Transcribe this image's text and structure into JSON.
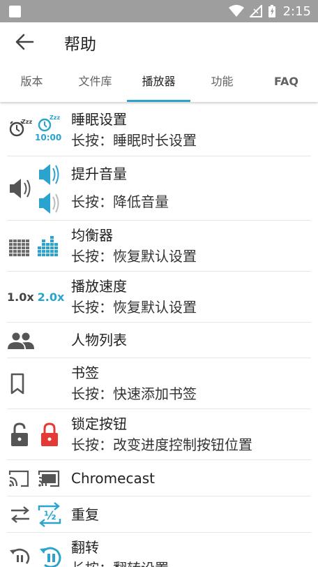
{
  "status": {
    "time": "2:15"
  },
  "appbar": {
    "title": "帮助"
  },
  "tabs": [
    {
      "label": "版本",
      "active": false
    },
    {
      "label": "文件库",
      "active": false
    },
    {
      "label": "播放器",
      "active": true
    },
    {
      "label": "功能",
      "active": false
    },
    {
      "label": "FAQ",
      "active": false
    }
  ],
  "items": [
    {
      "title": "睡眠设置",
      "sub": "长按：睡眠时长设置",
      "icon": "sleep-timer-icon",
      "icon_text": "10:00"
    },
    {
      "title": "提升音量",
      "sub": "降低音量",
      "sub_prefix": "长按：",
      "icon": "volume-boost-icon"
    },
    {
      "title": "均衡器",
      "sub": "长按：恢复默认设置",
      "icon": "equalizer-icon"
    },
    {
      "title": "播放速度",
      "sub": "长按：恢复默认设置",
      "icon": "playback-speed-icon",
      "speed_a": "1.0x",
      "speed_b": "2.0x"
    },
    {
      "title": "人物列表",
      "icon": "people-icon"
    },
    {
      "title": "书签",
      "sub": "长按：快速添加书签",
      "icon": "bookmark-icon"
    },
    {
      "title": "锁定按钮",
      "sub": "长按：改变进度控制按钮位置",
      "icon": "lock-icon"
    },
    {
      "title": "Chromecast",
      "icon": "cast-icon"
    },
    {
      "title": "重复",
      "icon": "repeat-icon",
      "icon_text": "½"
    },
    {
      "title": "翻转",
      "sub": "长按：翻转设置",
      "icon": "rewind-icon"
    }
  ],
  "colors": {
    "accent": "#2aa4cf",
    "lock_red": "#e53935",
    "status_bar": "#9e9e9e"
  }
}
